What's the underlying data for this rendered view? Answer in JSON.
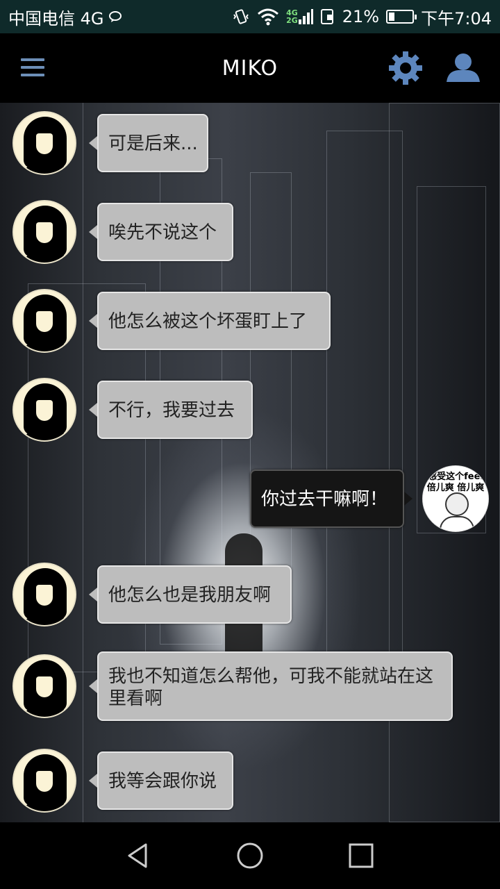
{
  "status_bar": {
    "carrier": "中国电信 4G",
    "net_top": "4G",
    "net_bottom": "2G",
    "battery": "21%",
    "battery_level": 0.21,
    "time": "下午7:04"
  },
  "app_bar": {
    "title": "MIKO",
    "icons": [
      "menu-icon",
      "gear-icon",
      "user-icon"
    ],
    "accent_color": "#5d86bd"
  },
  "messages": [
    {
      "from": "miko",
      "text": "可是后来..."
    },
    {
      "from": "miko",
      "text": "唉先不说这个"
    },
    {
      "from": "miko",
      "text": "他怎么被这个坏蛋盯上了"
    },
    {
      "from": "miko",
      "text": "不行，我要过去"
    },
    {
      "from": "me",
      "text": "你过去干嘛啊！"
    },
    {
      "from": "miko",
      "text": "他怎么也是我朋友啊"
    },
    {
      "from": "miko",
      "text": "我也不知道怎么帮他，可我不能就站在这里看啊"
    },
    {
      "from": "miko",
      "text": "我等会跟你说"
    }
  ],
  "self_avatar": {
    "line1": "感受这个feel",
    "line2": "倍儿爽 倍儿爽"
  },
  "nav_bar": {
    "icons": [
      "back-icon",
      "home-icon",
      "recents-icon"
    ]
  }
}
